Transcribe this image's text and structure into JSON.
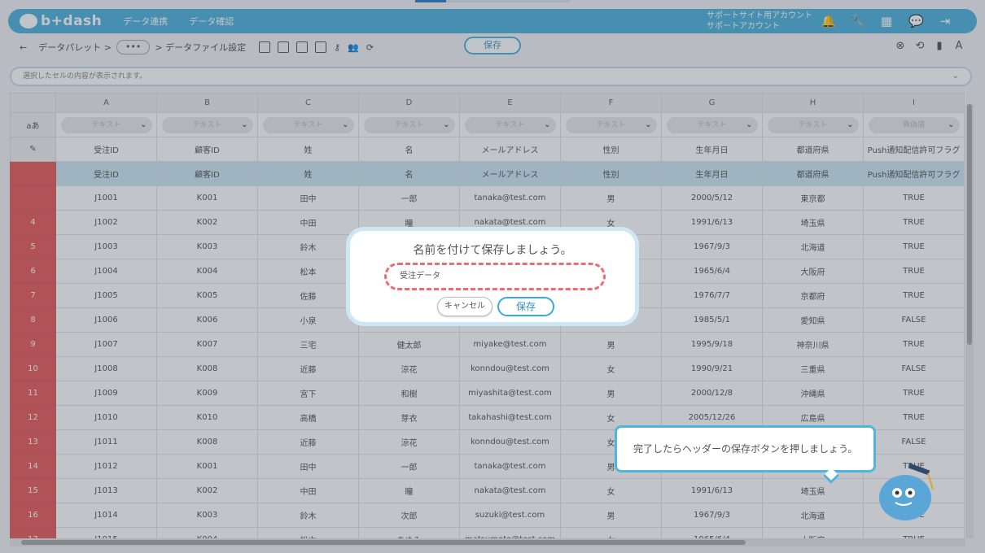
{
  "app": {
    "logo": "b+dash"
  },
  "nav": [
    "データ連携",
    "データ確認"
  ],
  "account": {
    "line1": "サポートサイト用アカウント",
    "line2": "サポートアカウント"
  },
  "toolbar": {
    "back": "←",
    "crumb1": "データパレット >",
    "dots": "•••",
    "crumb2": "> データファイル設定",
    "save_label": "保存"
  },
  "cellbar": {
    "placeholder": "選択したセルの内容が表示されます。"
  },
  "columns": [
    "A",
    "B",
    "C",
    "D",
    "E",
    "F",
    "G",
    "H",
    "I"
  ],
  "type_row": {
    "row_label": "aあ",
    "types": [
      "テキスト",
      "テキスト",
      "テキスト",
      "テキスト",
      "テキスト",
      "テキスト",
      "テキスト",
      "テキスト",
      "真偽値"
    ]
  },
  "header_row": [
    "受注ID",
    "顧客ID",
    "姓",
    "名",
    "メールアドレス",
    "性別",
    "生年月日",
    "都道府県",
    "Push通知配信許可フラグ"
  ],
  "rows": [
    {
      "n": "",
      "cells": [
        "受注ID",
        "顧客ID",
        "姓",
        "名",
        "メールアドレス",
        "性別",
        "生年月日",
        "都道府県",
        "Push通知配信許可フラグ"
      ]
    },
    {
      "n": "",
      "cells": [
        "J1001",
        "K001",
        "田中",
        "一郎",
        "tanaka@test.com",
        "男",
        "2000/5/12",
        "東京都",
        "TRUE"
      ]
    },
    {
      "n": "4",
      "cells": [
        "J1002",
        "K002",
        "中田",
        "瞳",
        "nakata@test.com",
        "女",
        "1991/6/13",
        "埼玉県",
        "TRUE"
      ]
    },
    {
      "n": "5",
      "cells": [
        "J1003",
        "K003",
        "鈴木",
        "",
        "",
        "",
        "1967/9/3",
        "北海道",
        "TRUE"
      ]
    },
    {
      "n": "6",
      "cells": [
        "J1004",
        "K004",
        "松本",
        "",
        "",
        "",
        "1965/6/4",
        "大阪府",
        "TRUE"
      ]
    },
    {
      "n": "7",
      "cells": [
        "J1005",
        "K005",
        "佐藤",
        "",
        "",
        "",
        "1976/7/7",
        "京都府",
        "TRUE"
      ]
    },
    {
      "n": "8",
      "cells": [
        "J1006",
        "K006",
        "小泉",
        "",
        "",
        "",
        "1985/5/1",
        "愛知県",
        "FALSE"
      ]
    },
    {
      "n": "9",
      "cells": [
        "J1007",
        "K007",
        "三宅",
        "健太郎",
        "miyake@test.com",
        "男",
        "1995/9/18",
        "神奈川県",
        "TRUE"
      ]
    },
    {
      "n": "10",
      "cells": [
        "J1008",
        "K008",
        "近藤",
        "涼花",
        "konndou@test.com",
        "女",
        "1990/9/21",
        "三重県",
        "FALSE"
      ]
    },
    {
      "n": "11",
      "cells": [
        "J1009",
        "K009",
        "宮下",
        "和樹",
        "miyashita@test.com",
        "男",
        "2000/12/8",
        "沖縄県",
        "TRUE"
      ]
    },
    {
      "n": "12",
      "cells": [
        "J1010",
        "K010",
        "高橋",
        "芽衣",
        "takahashi@test.com",
        "女",
        "2005/12/26",
        "広島県",
        "TRUE"
      ]
    },
    {
      "n": "13",
      "cells": [
        "J1011",
        "K008",
        "近藤",
        "涼花",
        "konndou@test.com",
        "女",
        "",
        "",
        "FALSE"
      ]
    },
    {
      "n": "14",
      "cells": [
        "J1012",
        "K001",
        "田中",
        "一郎",
        "tanaka@test.com",
        "男",
        "",
        "",
        "TRUE"
      ]
    },
    {
      "n": "15",
      "cells": [
        "J1013",
        "K002",
        "中田",
        "瞳",
        "nakata@test.com",
        "女",
        "1991/6/13",
        "埼玉県",
        "TRUE"
      ]
    },
    {
      "n": "16",
      "cells": [
        "J1014",
        "K003",
        "鈴木",
        "次郎",
        "suzuki@test.com",
        "男",
        "1967/9/3",
        "北海道",
        "TRUE"
      ]
    },
    {
      "n": "17",
      "cells": [
        "J1015",
        "K004",
        "松本",
        "あゆみ",
        "matsumoto@test.com",
        "女",
        "1965/6/4",
        "大阪府",
        "TRUE"
      ]
    }
  ],
  "modal": {
    "title": "名前を付けて保存しましょう。",
    "name_value": "受注データ",
    "cancel_label": "キャンセル",
    "save_label": "保存"
  },
  "tooltip": {
    "text": "完了したらヘッダーの保存ボタンを押しましょう。"
  },
  "colors": {
    "accent": "#4fb4de",
    "row_number": "#e85c5c",
    "dashed_highlight": "#ef6b73"
  }
}
